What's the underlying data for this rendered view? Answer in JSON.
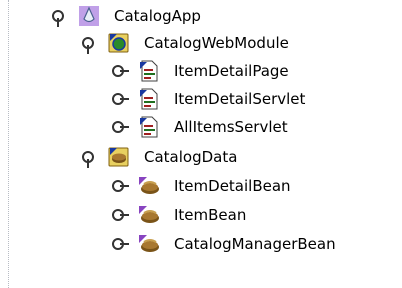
{
  "tree": {
    "app": {
      "label": "CatalogApp",
      "icon": "application-icon"
    },
    "web_module": {
      "label": "CatalogWebModule",
      "icon": "web-module-icon"
    },
    "web_items": [
      {
        "label": "ItemDetailPage",
        "icon": "jsp-page-icon"
      },
      {
        "label": "ItemDetailServlet",
        "icon": "servlet-icon"
      },
      {
        "label": "AllItemsServlet",
        "icon": "servlet-icon"
      }
    ],
    "data_module": {
      "label": "CatalogData",
      "icon": "ejb-module-icon"
    },
    "data_items": [
      {
        "label": "ItemDetailBean",
        "icon": "bean-icon"
      },
      {
        "label": "ItemBean",
        "icon": "bean-icon"
      },
      {
        "label": "CatalogManagerBean",
        "icon": "bean-icon"
      }
    ],
    "colors": {
      "selection": "#c0a0e8",
      "module_green": "#2a8a2a",
      "module_blue": "#1838a0",
      "folder_yellow": "#e8d060",
      "bean_brown": "#7a5418"
    }
  }
}
